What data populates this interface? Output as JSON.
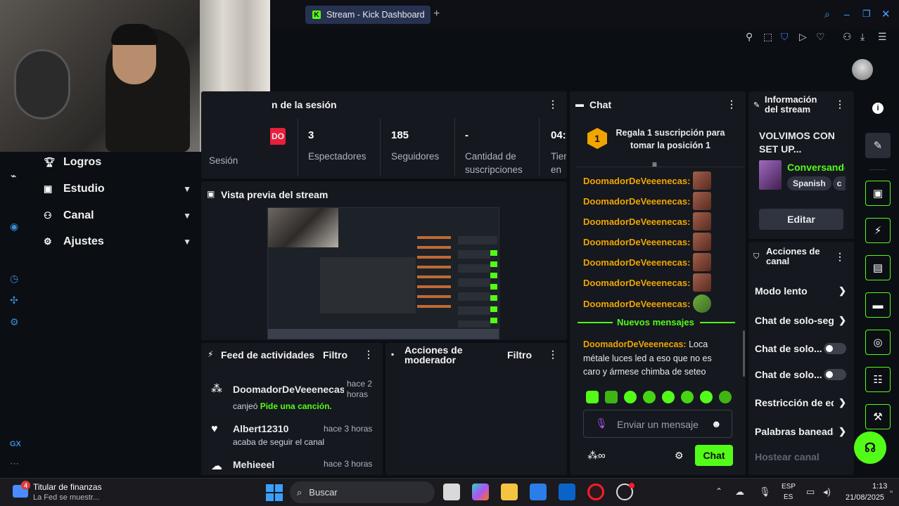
{
  "browser": {
    "tab_title": "Stream - Kick Dashboard",
    "new_tab": "+"
  },
  "sidebar": {
    "items": [
      {
        "label": "Logros",
        "icon": "trophy-icon",
        "chevron": false
      },
      {
        "label": "Estudio",
        "icon": "studio-icon",
        "chevron": true
      },
      {
        "label": "Canal",
        "icon": "users-icon",
        "chevron": true
      },
      {
        "label": "Ajustes",
        "icon": "gear-icon",
        "chevron": true
      }
    ],
    "rail_label": "GX"
  },
  "session": {
    "title": "n de la sesión",
    "live_badge": "DO",
    "session_label": "Sesión",
    "stats": [
      {
        "value": "3",
        "label": "Espectadores"
      },
      {
        "value": "185",
        "label": "Seguidores"
      },
      {
        "value": "-",
        "label": "Cantidad de suscripciones"
      },
      {
        "value": "04:",
        "label": "Tier en v"
      }
    ]
  },
  "preview": {
    "title": "Vista previa del stream"
  },
  "feed": {
    "title": "Feed de actividades",
    "filter": "Filtro",
    "items": [
      {
        "user": "DoomadorDeVeeenecas",
        "time": "hace 2 horas",
        "action": "canjeó",
        "highlight": "Pide una canción."
      },
      {
        "user": "Albert12310",
        "time": "hace 3 horas",
        "action": "acaba de seguir el canal",
        "highlight": ""
      },
      {
        "user": "Mehieeel",
        "time": "hace 3 horas",
        "action": "",
        "highlight": ""
      }
    ]
  },
  "mod_actions": {
    "title": "Acciones de moderador",
    "filter": "Filtro"
  },
  "chat": {
    "title": "Chat",
    "sub_prompt": "Regala 1 suscripción para tomar la posición 1",
    "rank": "1",
    "messages": [
      {
        "user": "DoomadorDeVeeenecas:",
        "emote": "emote"
      },
      {
        "user": "DoomadorDeVeeenecas:",
        "emote": "emote"
      },
      {
        "user": "DoomadorDeVeeenecas:",
        "emote": "emote"
      },
      {
        "user": "DoomadorDeVeeenecas:",
        "emote": "emote"
      },
      {
        "user": "DoomadorDeVeeenecas:",
        "emote": "emote"
      },
      {
        "user": "DoomadorDeVeeenecas:",
        "emote": "emote"
      },
      {
        "user": "DoomadorDeVeeenecas:",
        "emote": "frog"
      }
    ],
    "new_messages": "Nuevos mensajes",
    "last_user": "DoomadorDeVeeenecas:",
    "last_text": " Loca métale luces led a eso que no es caro y ármese chimba de seteo",
    "input_placeholder": "Enviar un mensaje",
    "send_label": "Chat"
  },
  "stream_info": {
    "title": "Información del stream",
    "stream_title": "VOLVIMOS CON SET UP...",
    "category": "Conversando",
    "tags": [
      "Spanish",
      "c"
    ],
    "edit_label": "Editar"
  },
  "channel_actions": {
    "title": "Acciones de canal",
    "items": [
      {
        "label": "Modo lento",
        "control": "arrow"
      },
      {
        "label": "Chat de solo-seg",
        "control": "arrow"
      },
      {
        "label": "Chat de solo...",
        "control": "toggle"
      },
      {
        "label": "Chat de solo...",
        "control": "toggle"
      },
      {
        "label": "Restricción de ed",
        "control": "arrow"
      },
      {
        "label": "Palabras baneada",
        "control": "arrow"
      },
      {
        "label": "Hostear canal",
        "control": "none"
      }
    ]
  },
  "taskbar": {
    "news_title": "Titular de finanzas",
    "news_sub": "La Fed se muestr...",
    "news_badge": "4",
    "search": "Buscar",
    "lang_top": "ESP",
    "lang_bottom": "ES",
    "time": "1:13",
    "date": "21/08/2025"
  },
  "colors": {
    "accent": "#53fc18",
    "username": "#f0a500",
    "panel": "#15181e",
    "live": "#e91e3b"
  }
}
